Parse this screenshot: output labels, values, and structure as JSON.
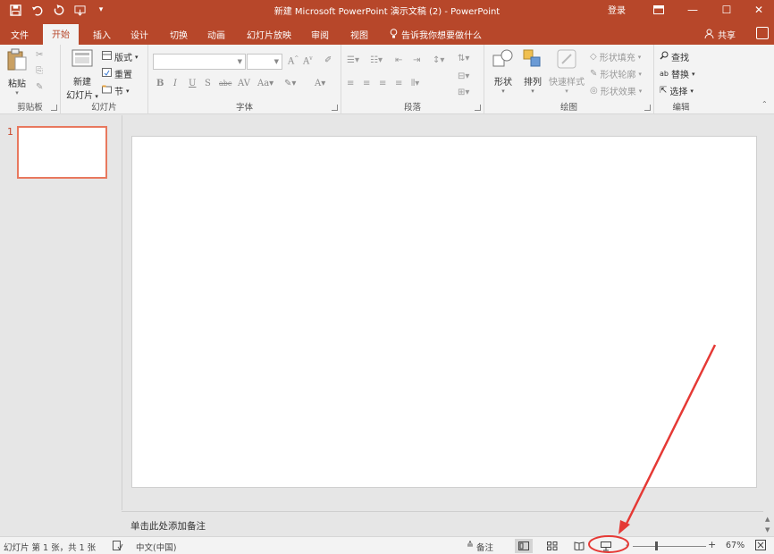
{
  "titlebar": {
    "title": "新建 Microsoft PowerPoint 演示文稿 (2)  -  PowerPoint",
    "login": "登录",
    "qat_icons": [
      "save-icon",
      "undo-icon",
      "redo-icon",
      "touch-mode-icon",
      "customize-icon"
    ]
  },
  "tabs": [
    "文件",
    "开始",
    "插入",
    "设计",
    "切换",
    "动画",
    "幻灯片放映",
    "审阅",
    "视图"
  ],
  "tell_me": "告诉我你想要做什么",
  "share": "共享",
  "ribbon": {
    "clipboard": {
      "label": "剪贴板",
      "paste": "粘贴"
    },
    "slides": {
      "label": "幻灯片",
      "new_slide_1": "新建",
      "new_slide_2": "幻灯片",
      "layout": "版式",
      "reset": "重置",
      "section": "节"
    },
    "font": {
      "label": "字体"
    },
    "paragraph": {
      "label": "段落"
    },
    "drawing": {
      "label": "绘图",
      "shapes": "形状",
      "arrange": "排列",
      "quick_styles": "快速样式",
      "shape_fill": "形状填充",
      "shape_outline": "形状轮廓",
      "shape_effects": "形状效果"
    },
    "editing": {
      "label": "编辑",
      "find": "查找",
      "replace": "替换",
      "select": "选择"
    }
  },
  "slide_panel": {
    "slide_number": "1"
  },
  "notes_placeholder": "单击此处添加备注",
  "status": {
    "slide_info": "幻灯片 第 1 张，共 1 张",
    "language": "中文(中国)",
    "notes": "备注",
    "zoom": "67%",
    "zoom_level": 0.67
  },
  "colors": {
    "accent": "#b7472a",
    "annotation": "#e53935"
  }
}
